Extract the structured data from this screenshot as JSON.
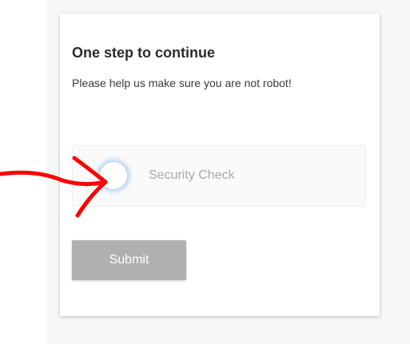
{
  "card": {
    "title": "One step to continue",
    "subtitle": "Please help us make sure you are not robot!"
  },
  "captcha": {
    "label": "Security Check",
    "checked": false
  },
  "form": {
    "submit_label": "Submit"
  },
  "colors": {
    "annotation_arrow": "#ff0000",
    "submit_bg": "#b0b0b0",
    "check_glow": "#78aae6"
  },
  "annotation": {
    "icon": "red-hand-drawn-arrow-icon"
  }
}
